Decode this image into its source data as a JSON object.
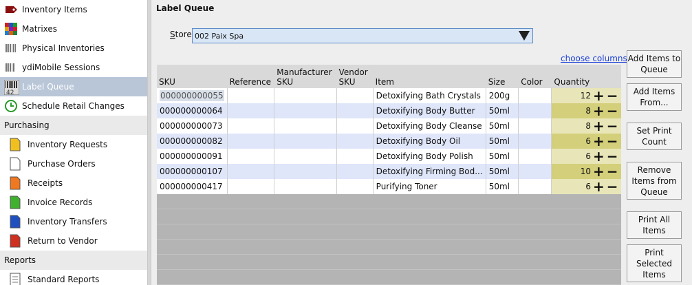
{
  "sidebar": {
    "items": [
      {
        "label": "Inventory Items",
        "icon": "tag-icon",
        "type": "item"
      },
      {
        "label": "Matrixes",
        "icon": "matrix-icon",
        "type": "item"
      },
      {
        "label": "Physical Inventories",
        "icon": "barcode-icon",
        "type": "item"
      },
      {
        "label": "ydiMobile Sessions",
        "icon": "barcode-icon",
        "type": "item"
      },
      {
        "label": "Label Queue",
        "icon": "label-barcode-icon",
        "type": "item",
        "selected": true
      },
      {
        "label": "Schedule Retail Changes",
        "icon": "clock-icon",
        "type": "item"
      }
    ],
    "purchasing_title": "Purchasing",
    "purchasing": [
      {
        "label": "Inventory Requests",
        "color": "#f0c020"
      },
      {
        "label": "Purchase Orders",
        "color": "#ffffff"
      },
      {
        "label": "Receipts",
        "color": "#f07820"
      },
      {
        "label": "Invoice Records",
        "color": "#40b030"
      },
      {
        "label": "Inventory Transfers",
        "color": "#2050c0"
      },
      {
        "label": "Return to Vendor",
        "color": "#d03020"
      }
    ],
    "reports_title": "Reports",
    "reports": [
      {
        "label": "Standard Reports"
      }
    ]
  },
  "main": {
    "title": "Label Queue",
    "store_label_u": "S",
    "store_label_rest": "tore",
    "store_value": "002 Paix Spa",
    "choose_columns": "choose columns",
    "columns": [
      {
        "line1": "",
        "line2": "SKU"
      },
      {
        "line1": "",
        "line2": "Reference"
      },
      {
        "line1": "Manufacturer",
        "line2": "SKU"
      },
      {
        "line1": "Vendor",
        "line2": "SKU"
      },
      {
        "line1": "",
        "line2": "Item"
      },
      {
        "line1": "",
        "line2": "Size"
      },
      {
        "line1": "",
        "line2": "Color"
      },
      {
        "line1": "",
        "line2": "Quantity"
      }
    ],
    "rows": [
      {
        "sku": "000000000055",
        "reference": "",
        "mfr_sku": "",
        "vendor_sku": "",
        "item": "Detoxifying Bath Crystals",
        "size": "200g",
        "color": "",
        "quantity": "12"
      },
      {
        "sku": "000000000064",
        "reference": "",
        "mfr_sku": "",
        "vendor_sku": "",
        "item": "Detoxifying Body Butter",
        "size": "50ml",
        "color": "",
        "quantity": "8"
      },
      {
        "sku": "000000000073",
        "reference": "",
        "mfr_sku": "",
        "vendor_sku": "",
        "item": "Detoxifying Body Cleanse",
        "size": "50ml",
        "color": "",
        "quantity": "8"
      },
      {
        "sku": "000000000082",
        "reference": "",
        "mfr_sku": "",
        "vendor_sku": "",
        "item": "Detoxifying Body Oil",
        "size": "50ml",
        "color": "",
        "quantity": "6"
      },
      {
        "sku": "000000000091",
        "reference": "",
        "mfr_sku": "",
        "vendor_sku": "",
        "item": "Detoxifying Body Polish",
        "size": "50ml",
        "color": "",
        "quantity": "6"
      },
      {
        "sku": "000000000107",
        "reference": "",
        "mfr_sku": "",
        "vendor_sku": "",
        "item": "Detoxifying Firming Bod...",
        "size": "50ml",
        "color": "",
        "quantity": "10"
      },
      {
        "sku": "000000000417",
        "reference": "",
        "mfr_sku": "",
        "vendor_sku": "",
        "item": "Purifying Toner",
        "size": "50ml",
        "color": "",
        "quantity": "6"
      }
    ],
    "plus_glyph": "+",
    "minus_glyph": "−",
    "buttons": [
      {
        "name": "add-items-to-queue-button",
        "label": "Add Items to Queue"
      },
      {
        "name": "add-items-from-button",
        "label": "Add Items From..."
      },
      {
        "name": "set-print-count-button",
        "label": "Set Print Count"
      },
      {
        "name": "remove-items-from-queue-button",
        "label": "Remove Items from Queue"
      },
      {
        "name": "print-all-items-button",
        "label": "Print All Items"
      },
      {
        "name": "print-selected-items-button",
        "label": "Print Selected Items"
      }
    ]
  },
  "colors": {
    "selected_nav": "#b8c6d8",
    "row_alt": "#dfe6fa",
    "qty_light": "#e8e6b8",
    "qty_dark": "#d4cf7a",
    "link": "#1a3fd6"
  }
}
